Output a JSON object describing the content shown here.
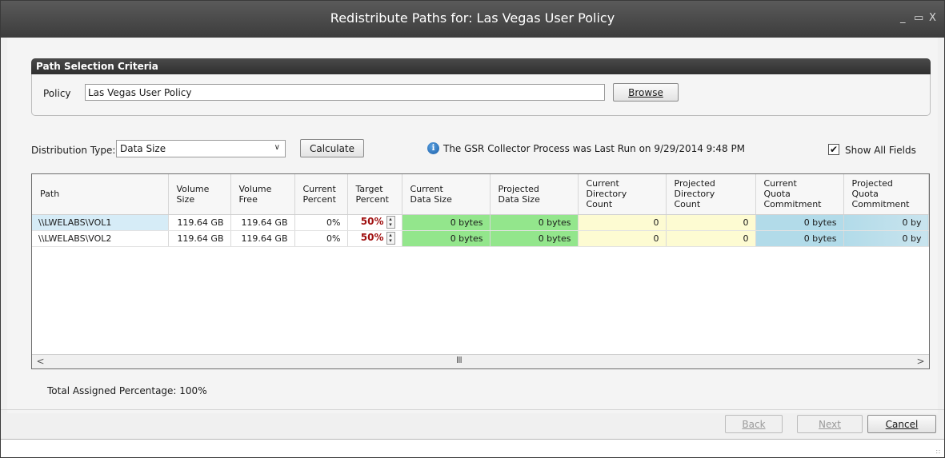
{
  "window": {
    "title": "Redistribute Paths for: Las Vegas User Policy",
    "minimize": "_",
    "maximize": "▭",
    "close": "X"
  },
  "criteria": {
    "header": "Path Selection Criteria",
    "policy_label": "Policy",
    "policy_value": "Las Vegas User Policy",
    "browse_label": "Browse"
  },
  "toolbar": {
    "distribution_label": "Distribution Type:",
    "distribution_value": "Data Size",
    "calculate_label": "Calculate",
    "info_text": "The GSR Collector Process was Last Run on 9/29/2014 9:48 PM",
    "show_all_label": "Show All Fields",
    "show_all_checked": true
  },
  "grid": {
    "columns": [
      [
        "Path"
      ],
      [
        "Volume",
        "Size"
      ],
      [
        "Volume",
        "Free"
      ],
      [
        "Current",
        "Percent"
      ],
      [
        "Target",
        "Percent"
      ],
      [
        "Current",
        "Data Size"
      ],
      [
        "Projected",
        "Data Size"
      ],
      [
        "Current",
        "Directory",
        "Count"
      ],
      [
        "Projected",
        "Directory",
        "Count"
      ],
      [
        "Current",
        "Quota",
        "Commitment"
      ],
      [
        "Projected",
        "Quota",
        "Commitment"
      ]
    ],
    "rows": [
      {
        "path": "\\\\LWELABS\\VOL1",
        "volume_size": "119.64 GB",
        "volume_free": "119.64 GB",
        "current_percent": "0%",
        "target_percent": "50%",
        "current_data_size": "0 bytes",
        "projected_data_size": "0 bytes",
        "current_dir_count": "0",
        "projected_dir_count": "0",
        "current_quota": "0 bytes",
        "projected_quota": "0 by"
      },
      {
        "path": "\\\\LWELABS\\VOL2",
        "volume_size": "119.64 GB",
        "volume_free": "119.64 GB",
        "current_percent": "0%",
        "target_percent": "50%",
        "current_data_size": "0 bytes",
        "projected_data_size": "0 bytes",
        "current_dir_count": "0",
        "projected_dir_count": "0",
        "current_quota": "0 bytes",
        "projected_quota": "0 by"
      }
    ],
    "scroll_left": "<",
    "scroll_right": ">",
    "scroll_grip": "III"
  },
  "summary": {
    "total_label": "Total Assigned Percentage: 100%"
  },
  "buttons": {
    "back_label": "Back",
    "next_label": "Next",
    "cancel_label": "Cancel"
  },
  "colors": {
    "green": "#93e68c",
    "yellow": "#fdfbd2",
    "blue": "#b2dbe9",
    "target_red": "#a01010"
  }
}
